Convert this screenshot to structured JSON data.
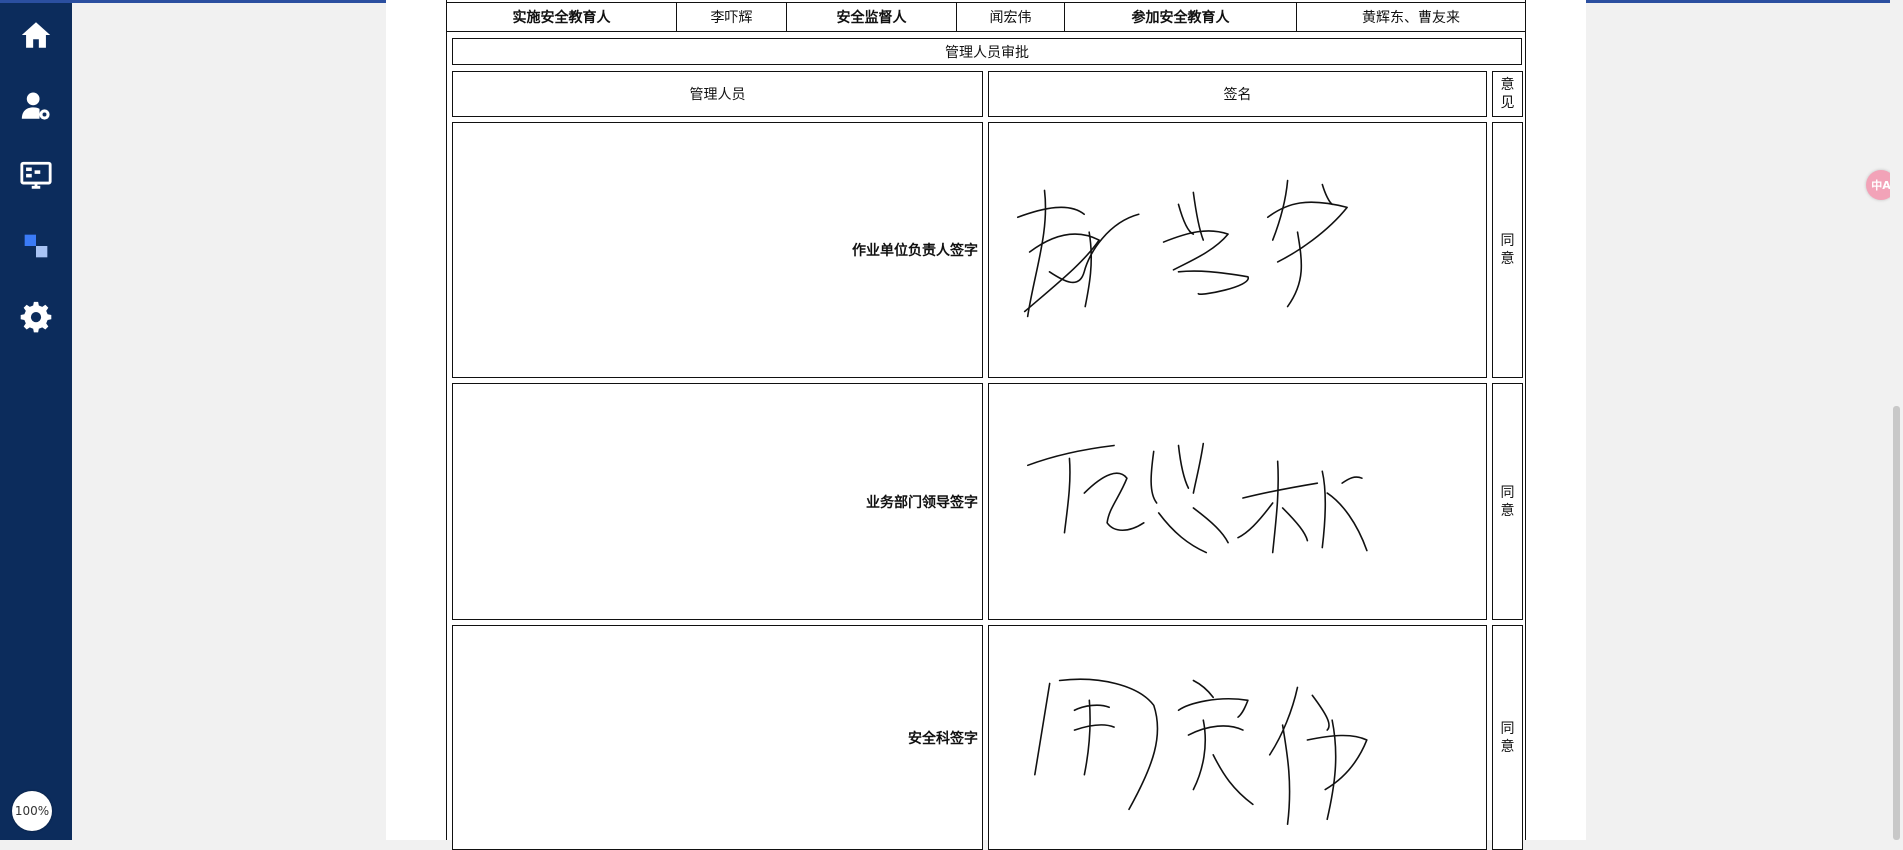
{
  "sidebar": {
    "items": [
      {
        "name": "home",
        "icon": "home-icon"
      },
      {
        "name": "user-settings",
        "icon": "user-gear-icon"
      },
      {
        "name": "monitor",
        "icon": "monitor-icon"
      },
      {
        "name": "modules",
        "icon": "squares-icon"
      },
      {
        "name": "settings",
        "icon": "gear-icon"
      }
    ],
    "zoom": "100%"
  },
  "top_row": {
    "cells": [
      {
        "text": "实施安全教育人",
        "bold": true
      },
      {
        "text": "李吓辉",
        "bold": false
      },
      {
        "text": "安全监督人",
        "bold": true
      },
      {
        "text": "闻宏伟",
        "bold": false
      },
      {
        "text": "参加安全教育人",
        "bold": true
      },
      {
        "text": "黄辉东、曹友来",
        "bold": false
      }
    ]
  },
  "approval": {
    "title": "管理人员审批",
    "headers": {
      "manager": "管理人员",
      "signature": "签名",
      "opinion": "意见"
    },
    "rows": [
      {
        "role": "作业单位负责人签字",
        "opinion": "同意"
      },
      {
        "role": "业务部门领导签字",
        "opinion": "同意"
      },
      {
        "role": "安全科签字",
        "opinion": "同意"
      }
    ]
  },
  "colors": {
    "sidebar": "#0c2c5c",
    "accent": "#3b7bf7"
  }
}
